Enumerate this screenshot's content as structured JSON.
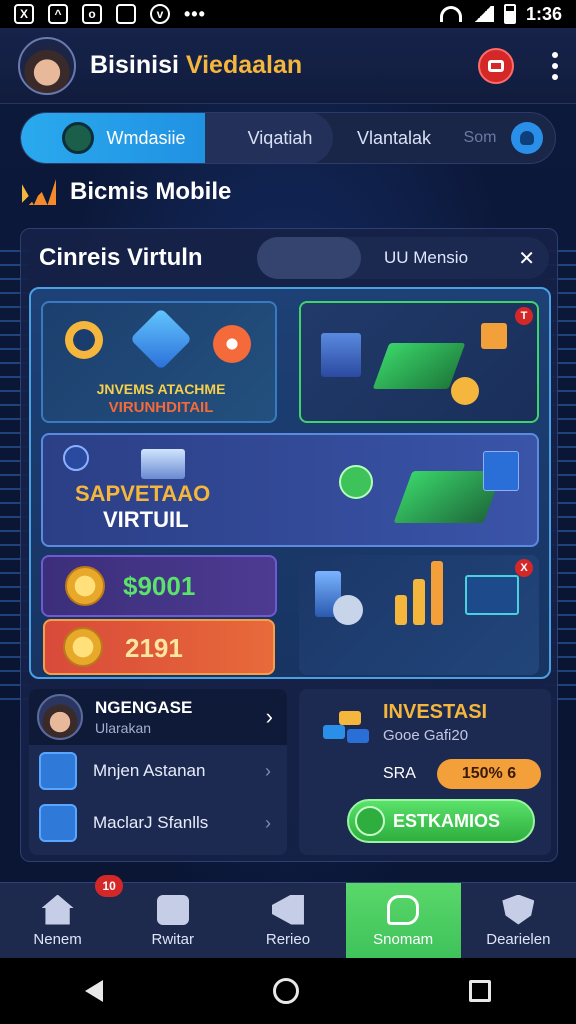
{
  "status_bar": {
    "time": "1:36"
  },
  "header": {
    "title_main": "Bisinisi",
    "title_accent": "Viedaalan"
  },
  "tabs": [
    {
      "label": "Wmdasiie"
    },
    {
      "label": "Viqatiah"
    },
    {
      "label": "Vlantalak"
    },
    {
      "label": "Som"
    }
  ],
  "section": {
    "title": "Bicmis Mobile"
  },
  "card": {
    "title": "Cinreis Virtuln",
    "toggle_label": "UU Mensio"
  },
  "promo": {
    "tile_a_line1": "JNVEMS ATACHME",
    "tile_a_line2": "VIRUNHDITAIL",
    "tile_b_badge": "T",
    "tile_c_line1": "SAPVETAAO",
    "tile_c_line2": "VIRTUIL",
    "tile_d_value": "$9001",
    "tile_e_value": "2191",
    "tile_f_badge": "X"
  },
  "left_panel": {
    "name": "NGENGASE",
    "subtitle": "Ularakan",
    "rows": [
      {
        "label": "Mnjen Astanan"
      },
      {
        "label": "MaclarJ Sfanlls"
      }
    ]
  },
  "right_panel": {
    "title": "INVESTASI",
    "subtitle": "Gooe Gafi20",
    "label": "SRA",
    "pill": "150% 6",
    "button": "ESTKAMIOS"
  },
  "bottom_nav": [
    {
      "label": "Nenem",
      "active": false
    },
    {
      "label": "Rwitar",
      "active": false
    },
    {
      "label": "Rerieo",
      "active": false
    },
    {
      "label": "Snomam",
      "active": true
    },
    {
      "label": "Dearielen",
      "active": false
    }
  ],
  "nav_badge": "10",
  "colors": {
    "accent_gold": "#f4b63c",
    "accent_blue": "#2aa9ee",
    "accent_green": "#5ae26a",
    "alert_red": "#d42828",
    "background": "#0b1634"
  },
  "icons": {
    "header_action": "record-icon",
    "menu": "kebab-icon",
    "toggle_action": "pin-icon",
    "nav": [
      "home-icon",
      "chat-icon",
      "megaphone-icon",
      "message-icon",
      "shield-icon"
    ]
  }
}
